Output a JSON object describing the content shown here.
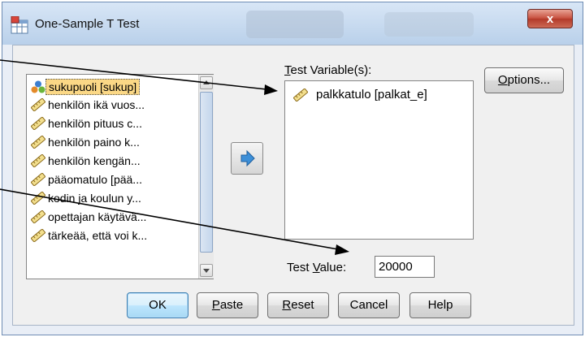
{
  "window": {
    "title": "One-Sample T Test",
    "close_label": "x"
  },
  "variable_list": {
    "items": [
      {
        "label": "sukupuoli [sukup]",
        "icon": "nominal-variable-icon",
        "selected": true
      },
      {
        "label": "henkilön ikä vuos...",
        "icon": "scale-ruler-icon"
      },
      {
        "label": "henkilön pituus c...",
        "icon": "scale-ruler-icon"
      },
      {
        "label": "henkilön paino k...",
        "icon": "scale-ruler-icon"
      },
      {
        "label": "henkilön kengän...",
        "icon": "scale-ruler-icon"
      },
      {
        "label": "pääomatulo [pää...",
        "icon": "scale-ruler-icon"
      },
      {
        "label": "kodin ja koulun y...",
        "icon": "scale-ruler-icon"
      },
      {
        "label": "opettajan käytävä...",
        "icon": "scale-ruler-icon"
      },
      {
        "label": "tärkeää, että voi k...",
        "icon": "scale-ruler-icon"
      }
    ]
  },
  "test_variables": {
    "label": "Test Variable(s):",
    "items": [
      {
        "label": "palkkatulo [palkat_e]",
        "icon": "scale-ruler-icon"
      }
    ]
  },
  "options_label": "Options...",
  "test_value": {
    "label": "Test Value:",
    "value": "20000"
  },
  "buttons": {
    "ok": "OK",
    "paste": "Paste",
    "reset": "Reset",
    "cancel": "Cancel",
    "help": "Help"
  },
  "colors": {
    "selection": "#fbd886",
    "accent_blue": "#3c8fd8",
    "close_red": "#c8513f"
  }
}
